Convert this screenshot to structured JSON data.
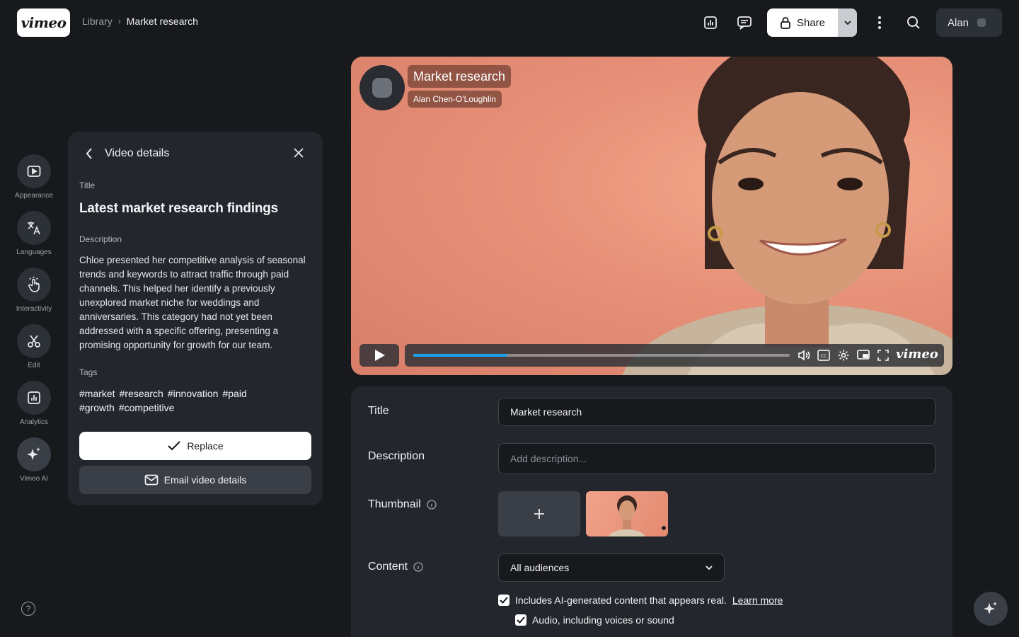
{
  "app": {
    "logo": "vimeo"
  },
  "breadcrumb": {
    "library": "Library",
    "separator": "›",
    "current": "Market research"
  },
  "topbar": {
    "share_label": "Share",
    "user_name": "Alan"
  },
  "rail": {
    "items": [
      {
        "label": "Appearance",
        "icon": "play-square-icon"
      },
      {
        "label": "Languages",
        "icon": "translate-icon"
      },
      {
        "label": "Interactivity",
        "icon": "tap-icon"
      },
      {
        "label": "Edit",
        "icon": "scissors-icon"
      },
      {
        "label": "Analytics",
        "icon": "chart-icon"
      },
      {
        "label": "Vimeo AI",
        "icon": "sparkle-icon"
      }
    ],
    "help": "?"
  },
  "panel": {
    "heading": "Video details",
    "title_label": "Title",
    "title": "Latest market research findings",
    "description_label": "Description",
    "description": "Chloe presented her competitive analysis of seasonal trends and keywords to attract traffic through paid channels. This helped her identify a previously unexplored market niche for weddings and anniversaries. This category had not yet been addressed with a specific offering, presenting a promising opportunity for growth for our team.",
    "tags_label": "Tags",
    "tags": [
      "#market",
      "#research",
      "#innovation",
      "#paid",
      "#growth",
      "#competitive"
    ],
    "replace_label": "Replace",
    "email_label": "Email video details"
  },
  "video": {
    "title": "Market research",
    "author": "Alan Chen-O'Loughlin",
    "progress": 0.25,
    "player_logo": "vimeo",
    "cc": "CC"
  },
  "form": {
    "title_label": "Title",
    "title_value": "Market research",
    "description_label": "Description",
    "description_placeholder": "Add description...",
    "thumbnail_label": "Thumbnail",
    "content_label": "Content",
    "content_value": "All audiences",
    "ai_check_label": "Includes AI-generated content that appears real.",
    "learn_more": "Learn more",
    "audio_check_label": "Audio, including voices or sound"
  },
  "colors": {
    "accent": "#17a3e8",
    "background": "#17191d",
    "panel": "#23262c"
  }
}
